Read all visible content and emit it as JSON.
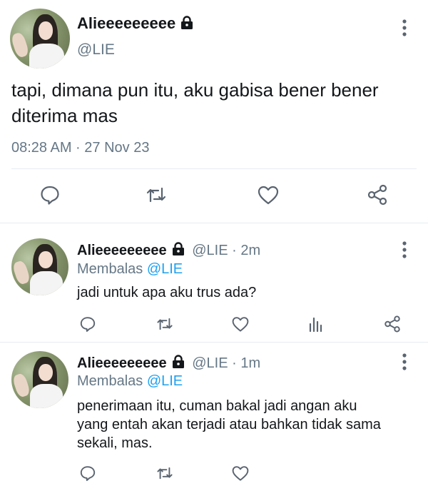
{
  "main_tweet": {
    "display_name": "Alieeeeeeeee",
    "handle": "@LIE",
    "text_line1": "tapi, dimana pun itu, aku gabisa bener bener",
    "text_line2": "diterima mas",
    "timestamp": "08:28 AM · 27 Nov 23"
  },
  "replies": [
    {
      "display_name": "Alieeeeeeeee",
      "meta": "@LIE · 2m",
      "replying_prefix": "Membalas",
      "replying_to": "@LIE",
      "text_lines": [
        "jadi untuk apa aku trus ada?"
      ]
    },
    {
      "display_name": "Alieeeeeeeee",
      "meta": "@LIE · 1m",
      "replying_prefix": "Membalas",
      "replying_to": "@LIE",
      "text_lines": [
        "penerimaan itu, cuman bakal jadi angan aku",
        "yang entah akan terjadi atau bahkan tidak sama",
        "sekali, mas."
      ]
    }
  ],
  "icons": {
    "protected": "lock-icon",
    "actions": [
      "reply-icon",
      "retweet-icon",
      "like-icon",
      "analytics-icon",
      "share-icon"
    ],
    "overflow": "more-vertical-icon"
  },
  "colors": {
    "text": "#14171a",
    "muted": "#657786",
    "link": "#1da1f2",
    "divider": "#e6ecf0"
  }
}
